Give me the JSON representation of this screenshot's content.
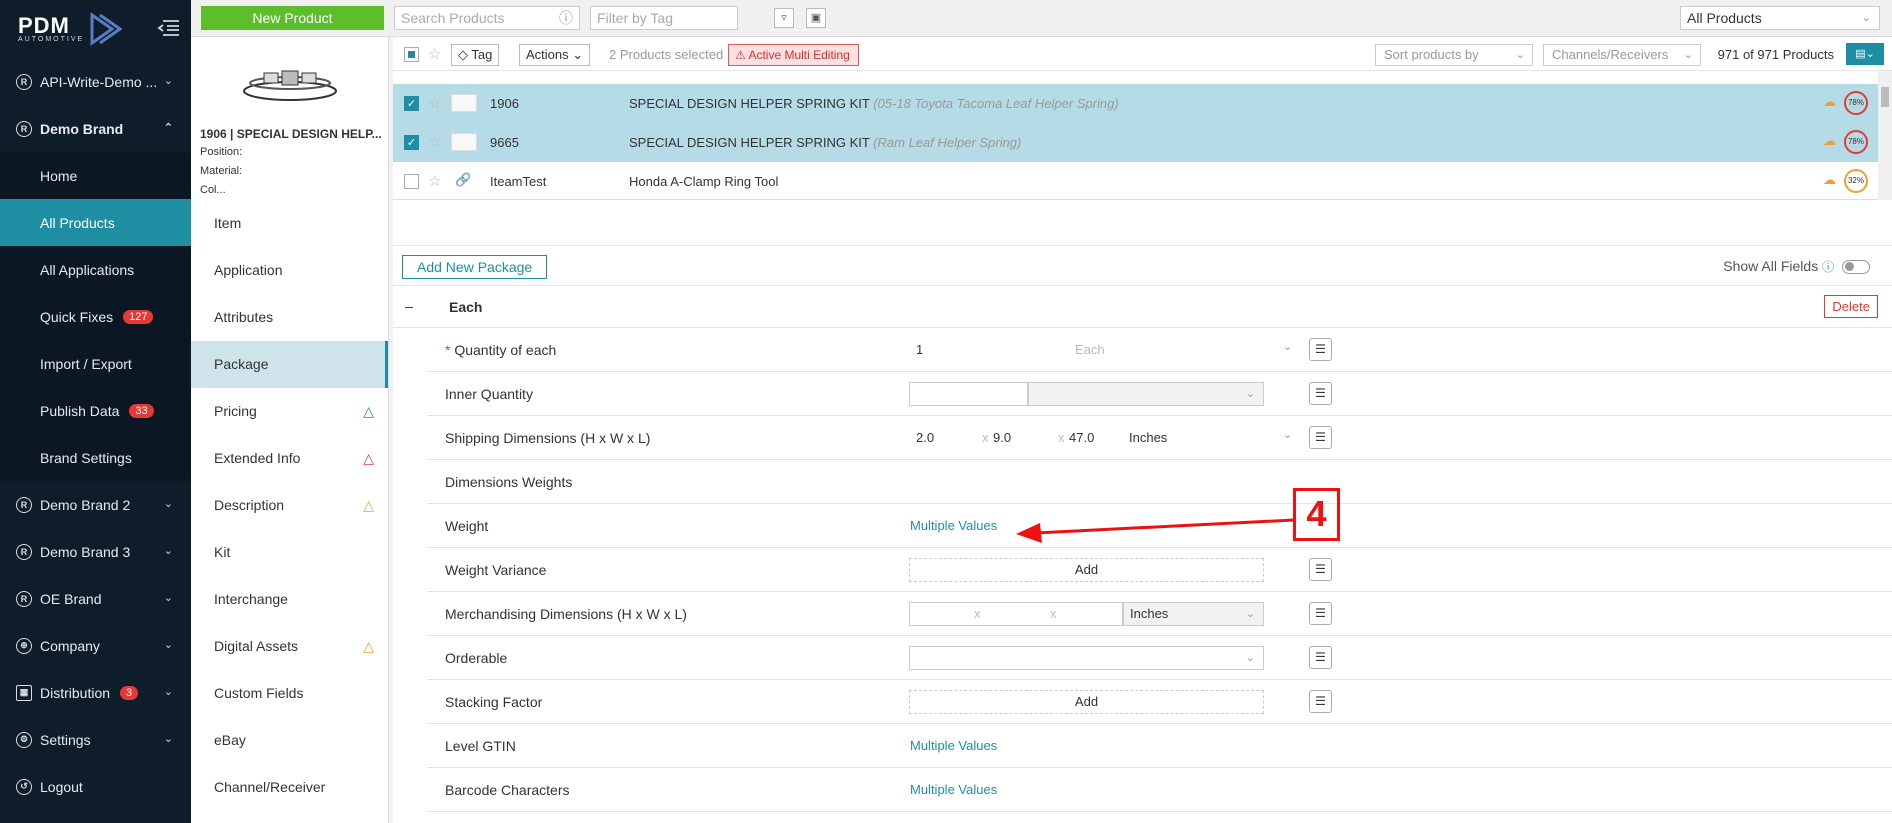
{
  "sidebar": {
    "logo_main": "PDM",
    "logo_sub": "AUTOMOTIVE",
    "items": [
      {
        "label": "API-Write-Demo ..."
      },
      {
        "label": "Demo Brand"
      },
      {
        "label": "Demo Brand 2"
      },
      {
        "label": "Demo Brand 3"
      },
      {
        "label": "OE Brand"
      },
      {
        "label": "Company"
      },
      {
        "label": "Distribution",
        "badge": "3"
      },
      {
        "label": "Settings"
      },
      {
        "label": "Logout"
      }
    ],
    "sub_items": [
      {
        "label": "Home"
      },
      {
        "label": "All Products"
      },
      {
        "label": "All Applications"
      },
      {
        "label": "Quick Fixes",
        "badge": "127"
      },
      {
        "label": "Import / Export"
      },
      {
        "label": "Publish Data",
        "badge": "33"
      },
      {
        "label": "Brand Settings"
      }
    ]
  },
  "topbar": {
    "new_product": "New Product",
    "search_placeholder": "Search Products",
    "tag_placeholder": "Filter by Tag",
    "scope": "All Products"
  },
  "preview": {
    "name": "1906 | SPECIAL DESIGN HELP...",
    "position_label": "Position:",
    "material_label": "Material:",
    "color_label": "Col..."
  },
  "list": {
    "tag_btn": "Tag",
    "actions_btn": "Actions",
    "selected_text": "2 Products selected",
    "multi_edit": "Active Multi Editing",
    "sort_placeholder": "Sort products by",
    "channels_placeholder": "Channels/Receivers",
    "count_text": "971 of 971 Products",
    "rows": [
      {
        "part": "1906",
        "desc": "SPECIAL DESIGN HELPER SPRING KIT",
        "note": "(05-18 Toyota Tacoma Leaf Helper Spring)",
        "pct": "78%"
      },
      {
        "part": "9665",
        "desc": "SPECIAL DESIGN HELPER SPRING KIT",
        "note": "(Ram Leaf Helper Spring)",
        "pct": "78%"
      },
      {
        "part": "IteamTest",
        "desc": "Honda A-Clamp Ring Tool",
        "note": "",
        "pct": "32%"
      }
    ]
  },
  "subnav": {
    "items": [
      {
        "label": "Item"
      },
      {
        "label": "Application"
      },
      {
        "label": "Attributes"
      },
      {
        "label": "Package"
      },
      {
        "label": "Pricing"
      },
      {
        "label": "Extended Info"
      },
      {
        "label": "Description"
      },
      {
        "label": "Kit"
      },
      {
        "label": "Interchange"
      },
      {
        "label": "Digital Assets"
      },
      {
        "label": "Custom Fields"
      },
      {
        "label": "eBay"
      },
      {
        "label": "Channel/Receiver"
      }
    ]
  },
  "package": {
    "add_new": "Add New Package",
    "show_all_fields": "Show All Fields",
    "section_label": "Each",
    "delete": "Delete",
    "fields": {
      "quantity_of_each": {
        "label": "Quantity of each",
        "value": "1",
        "unit": "Each"
      },
      "inner_quantity": {
        "label": "Inner Quantity"
      },
      "shipping_dimensions": {
        "label": "Shipping Dimensions (H x W x L)",
        "h": "2.0",
        "w": "9.0",
        "l": "47.0",
        "unit": "Inches"
      },
      "dimensions_weights": {
        "label": "Dimensions Weights"
      },
      "weight": {
        "label": "Weight",
        "value": "Multiple Values"
      },
      "weight_variance": {
        "label": "Weight Variance",
        "value": "Add"
      },
      "merch_dimensions": {
        "label": "Merchandising Dimensions (H x W x L)",
        "unit": "Inches"
      },
      "orderable": {
        "label": "Orderable"
      },
      "stacking_factor": {
        "label": "Stacking Factor",
        "value": "Add"
      },
      "level_gtin": {
        "label": "Level GTIN",
        "value": "Multiple Values"
      },
      "barcode_characters": {
        "label": "Barcode Characters",
        "value": "Multiple Values"
      }
    },
    "x_sep": "x"
  },
  "annotation": {
    "number": "4",
    "color": "#e11111"
  },
  "colors": {
    "sidebar_bg": "#0f1d2b",
    "accent": "#1e8fa3",
    "new_product": "#5cbe2a",
    "selected_row": "#b5dbe6"
  }
}
